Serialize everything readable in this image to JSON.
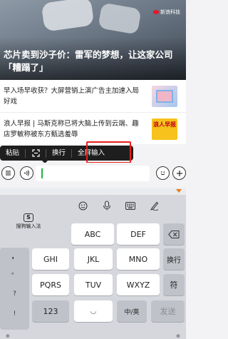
{
  "hero": {
    "source": "新浪科技",
    "title": "芯片卖到沙子价：雷军的梦想，让这家公司「糟蹋了」"
  },
  "news": [
    {
      "text": "早入场早收获？大屏营销上演广告主加速入局好戏"
    },
    {
      "text": "浪人早报 | 马斯克称已将大脑上传到云端、趣店罗敏称被东方甄选羞辱",
      "thumb_label": "浪人早报"
    }
  ],
  "context_menu": {
    "items": [
      "粘贴",
      "换行",
      "全屏输入"
    ],
    "scan_icon": "scan-icon",
    "highlight_color": "#e8201b"
  },
  "input_bar": {
    "left_icon": "menu-icon",
    "voice_icon": "voice-icon",
    "emoji_icon": "emoji-icon",
    "plus_icon": "plus-icon",
    "caret_color": "#1fb344"
  },
  "keyboard": {
    "brand_label": "搜狗输入法",
    "brand_icon": "S",
    "toolbar_icons": [
      "emoji-icon",
      "microphone-icon",
      "keyboard-icon",
      "handwriting-icon"
    ],
    "rows": [
      [
        "ABC",
        "DEF"
      ],
      [
        "GHI",
        "JKL",
        "MNO"
      ],
      [
        "PQRS",
        "TUV",
        "WXYZ"
      ]
    ],
    "side_chars": [
      "，",
      "。",
      "?",
      "!"
    ],
    "newline": "换行",
    "symbols": "符",
    "num_key": "123",
    "space_hint": "◡",
    "lang_key": "中/英",
    "send": "发送",
    "backspace_icon": "backspace-icon",
    "bottom_left": "⊕",
    "bottom_right": "⊕"
  }
}
